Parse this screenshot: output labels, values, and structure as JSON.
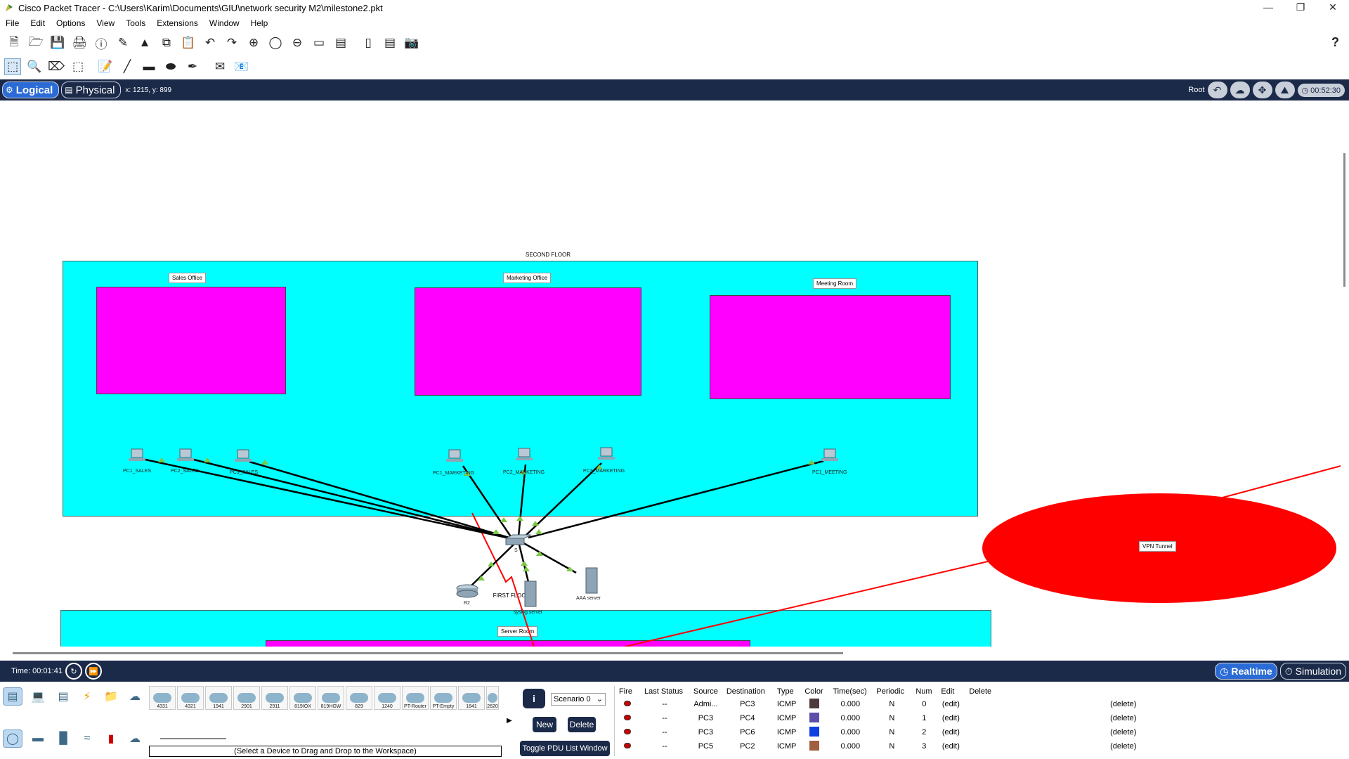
{
  "window": {
    "title": "Cisco Packet Tracer - C:\\Users\\Karim\\Documents\\GIU\\network security M2\\milestone2.pkt"
  },
  "menu": [
    "File",
    "Edit",
    "Options",
    "View",
    "Tools",
    "Extensions",
    "Window",
    "Help"
  ],
  "toolbar1_icons": [
    "new-file-icon",
    "open-folder-icon",
    "save-icon",
    "print-icon",
    "info-icon",
    "activity-wizard-icon",
    "network-info-icon",
    "copy-icon",
    "paste-icon",
    "undo-icon",
    "redo-icon",
    "zoom-in-icon",
    "zoom-reset-icon",
    "zoom-out-icon",
    "drawing-palette-icon",
    "custom-device-icon",
    "viewport-icon",
    "pdu-list-icon",
    "camera-icon"
  ],
  "toolbar2_icons": [
    "select-icon",
    "inspect-icon",
    "delete-icon",
    "resize-icon",
    "note-icon",
    "line-icon",
    "rectangle-icon",
    "ellipse-icon",
    "freeform-icon",
    "simple-pdu-icon",
    "complex-pdu-icon"
  ],
  "modebar": {
    "logical_label": "Logical",
    "physical_label": "Physical",
    "coords": "x: 1215, y: 899",
    "root_label": "Root",
    "clock": "00:52:30"
  },
  "workspace": {
    "second_floor_label": "SECOND FLOOR",
    "first_floor_label": "FIRST FLOOR",
    "sales_office": "Sales Office",
    "marketing_office": "Marketing Office",
    "meeting_room": "Meeting Room",
    "server_room": "Server Room",
    "vpn_tunnel": "VPN Tunnel",
    "devices": {
      "pc1_sales": "PC1_SALES",
      "pc2_sales": "PC2_SALES",
      "pc3_sales": "PC3_SALES",
      "pc1_marketing": "PC1_MARKETING",
      "pc2_marketing": "PC2_MARKETING",
      "pc3_marketing": "PC3_MARKETING",
      "pc1_meeting": "PC1_MEETING",
      "switch": "S",
      "router": "R2",
      "syslog": "syslog server",
      "aaa": "AAA server"
    }
  },
  "timebar": {
    "time": "Time: 00:01:41",
    "realtime": "Realtime",
    "simulation": "Simulation"
  },
  "device_tiles": [
    "4331",
    "4321",
    "1941",
    "2901",
    "2911",
    "819IOX",
    "819HGW",
    "829",
    "1240",
    "PT-Router",
    "PT-Empty",
    "1841",
    "2620"
  ],
  "hint": "(Select a Device to Drag and Drop to the Workspace)",
  "scenario": {
    "info": "i",
    "selected": "Scenario 0",
    "new": "New",
    "delete": "Delete",
    "toggle": "Toggle PDU List Window"
  },
  "pdu_table": {
    "headers": [
      "Fire",
      "Last Status",
      "Source",
      "Destination",
      "Type",
      "Color",
      "Time(sec)",
      "Periodic",
      "Num",
      "Edit",
      "Delete"
    ],
    "rows": [
      {
        "status": "--",
        "source": "Admi...",
        "dest": "PC3",
        "type": "ICMP",
        "color": "#4d3a3a",
        "time": "0.000",
        "periodic": "N",
        "num": "0",
        "edit": "(edit)",
        "delete": "(delete)"
      },
      {
        "status": "--",
        "source": "PC3",
        "dest": "PC4",
        "type": "ICMP",
        "color": "#5b4fa8",
        "time": "0.000",
        "periodic": "N",
        "num": "1",
        "edit": "(edit)",
        "delete": "(delete)"
      },
      {
        "status": "--",
        "source": "PC3",
        "dest": "PC6",
        "type": "ICMP",
        "color": "#1040e0",
        "time": "0.000",
        "periodic": "N",
        "num": "2",
        "edit": "(edit)",
        "delete": "(delete)"
      },
      {
        "status": "--",
        "source": "PC5",
        "dest": "PC2",
        "type": "ICMP",
        "color": "#a06040",
        "time": "0.000",
        "periodic": "N",
        "num": "3",
        "edit": "(edit)",
        "delete": "(delete)"
      }
    ]
  },
  "colors": {
    "floor": "#00ffff",
    "office": "#ff00ff",
    "vpn": "#ff0000",
    "navbar": "#1b2a49",
    "accent": "#2b6bd6"
  }
}
